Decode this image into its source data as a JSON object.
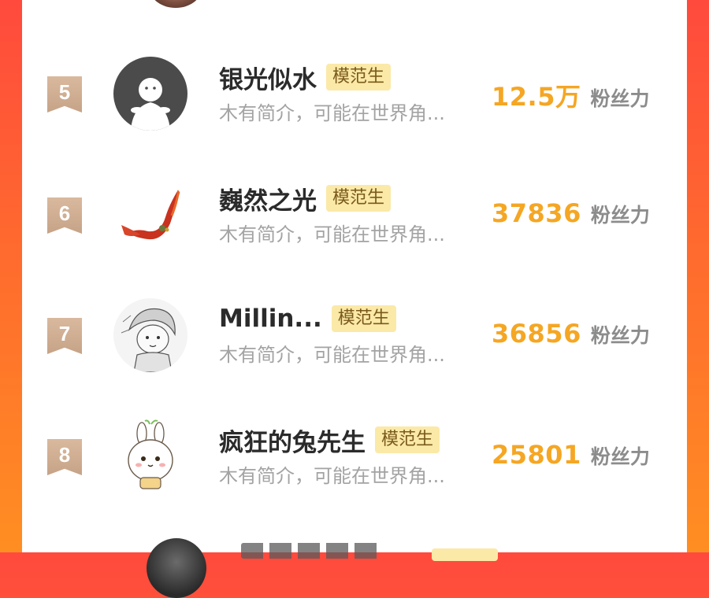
{
  "leaderboard": {
    "rows": [
      {
        "rank": "5",
        "name": "银光似水",
        "badge": "模范生",
        "bio": "木有简介，可能在世界角...",
        "count": "12.5万",
        "count_label": "粉丝力",
        "avatar_icon": "default-ghost-avatar"
      },
      {
        "rank": "6",
        "name": "巍然之光",
        "badge": "模范生",
        "bio": "木有简介，可能在世界角...",
        "count": "37836",
        "count_label": "粉丝力",
        "avatar_icon": "red-ribbon-avatar"
      },
      {
        "rank": "7",
        "name": "Millin...",
        "badge": "模范生",
        "bio": "木有简介，可能在世界角...",
        "count": "36856",
        "count_label": "粉丝力",
        "avatar_icon": "sketch-anime-avatar"
      },
      {
        "rank": "8",
        "name": "疯狂的兔先生",
        "badge": "模范生",
        "bio": "木有简介，可能在世界角...",
        "count": "25801",
        "count_label": "粉丝力",
        "avatar_icon": "bunny-cartoon-avatar"
      }
    ]
  },
  "colors": {
    "accent": "#f5a623",
    "badge_bg": "#fbe9a8",
    "rank_flag": "#c6a387",
    "background_start": "#ff4a3d",
    "background_end": "#ff8e22"
  }
}
